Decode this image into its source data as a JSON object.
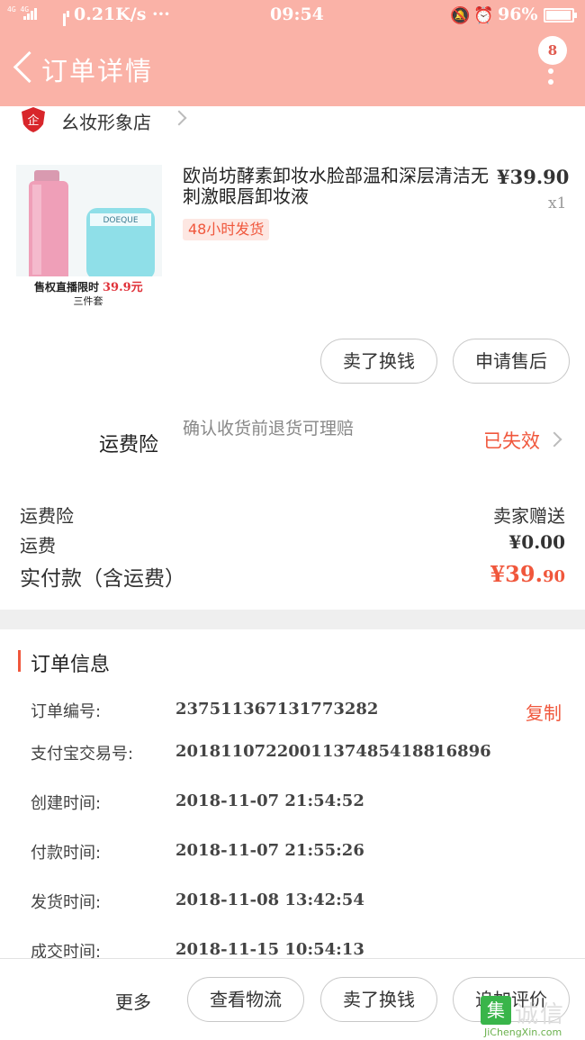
{
  "status_bar": {
    "signal_left": "4G 4G",
    "speed": "0.21K/s ···",
    "time": "09:54",
    "battery": "96%"
  },
  "nav": {
    "title": "订单详情",
    "badge_count": "8"
  },
  "shop": {
    "logo_text": "企",
    "name": "幺妆形象店"
  },
  "product": {
    "title": "欧尚坊酵素卸妆水脸部温和深层清洁无刺激眼唇卸妆液",
    "price": "¥39.90",
    "quantity": "x1",
    "tag": "48小时发货",
    "image_brand": "DOEQUE",
    "image_caption_prefix": "售权直播限时",
    "image_caption_price": "39.9元",
    "image_caption_sub": "三件套"
  },
  "actions": {
    "sell_for_cash": "卖了换钱",
    "after_sales": "申请售后"
  },
  "insurance": {
    "label": "运费险",
    "description": "确认收货前退货可理赔",
    "status": "已失效"
  },
  "fees": {
    "insurance_label": "运费险",
    "insurance_value": "卖家赠送",
    "shipping_label": "运费",
    "shipping_value": "¥0.00",
    "total_label": "实付款（含运费）",
    "total_value_main": "¥39.",
    "total_value_cents": "90"
  },
  "order_info": {
    "heading": "订单信息",
    "copy_label": "复制",
    "rows": [
      {
        "label": "订单编号:",
        "value": "237511367131773282"
      },
      {
        "label": "支付宝交易号:",
        "value": "2018110722001137485418816896"
      },
      {
        "label": "创建时间:",
        "value": "2018-11-07 21:54:52"
      },
      {
        "label": "付款时间:",
        "value": "2018-11-07 21:55:26"
      },
      {
        "label": "发货时间:",
        "value": "2018-11-08 13:42:54"
      },
      {
        "label": "成交时间:",
        "value": "2018-11-15 10:54:13"
      }
    ]
  },
  "bottom_bar": {
    "more": "更多",
    "view_logistics": "查看物流",
    "sell_for_cash": "卖了换钱",
    "add_review": "追加评价"
  },
  "watermark": {
    "mark": "集",
    "cn": "诚信",
    "en": "JiChengXin.com"
  },
  "colors": {
    "header_bg": "#fab2a7",
    "accent": "#f0573c"
  }
}
